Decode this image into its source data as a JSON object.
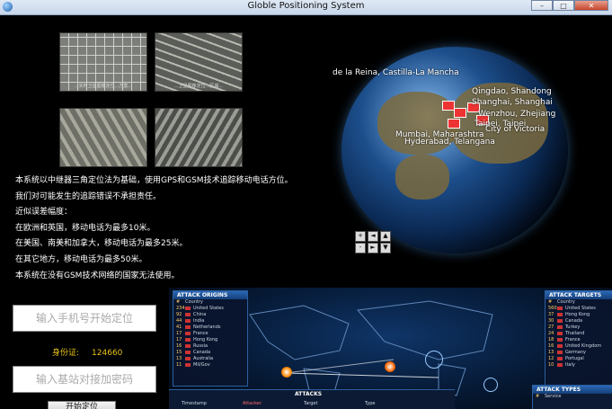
{
  "window": {
    "title": "Globle Positioning System"
  },
  "thumbnails": [
    {
      "caption": "...实时卫星图像定位...方案..."
    },
    {
      "caption": "...卫星图像定位...区域..."
    },
    {
      "caption": ""
    },
    {
      "caption": ""
    }
  ],
  "info_lines": [
    "本系统以中继器三角定位法为基础，使用GPS和GSM技术追踪移动电话方位。",
    "我们对可能发生的追踪错误不承担责任。",
    "近似误差幅度：",
    "在欧洲和英国，移动电话为最多10米。",
    "在美国、南美和加拿大，移动电话为最多25米。",
    "在其它地方，移动电话为最多50米。",
    "本系统在没有GSM技术网络的国家无法使用。"
  ],
  "phone_input": {
    "placeholder": "输入手机号开始定位"
  },
  "id_row": {
    "label": "身份证:",
    "value": "124660"
  },
  "base_input": {
    "placeholder": "输入基站对接加密码"
  },
  "start_button": {
    "label": "开始定位"
  },
  "globe": {
    "labels": [
      "de la Reina, Castilla-La Mancha",
      "Qingdao, Shandong",
      "Shanghai, Shanghai",
      "Wenzhou, Zhejiang",
      "Taipei, Taipei",
      "City of Victoria",
      "Mumbai, Maharashtra",
      "Hyderabad, Telangana"
    ],
    "nav_glyphs": {
      "plus": "+",
      "left": "◄",
      "up": "▲",
      "minus": "-",
      "right": "►",
      "down": "▼"
    }
  },
  "attack_map": {
    "origins": {
      "title": "ATTACK ORIGINS",
      "header": [
        "#",
        "Country"
      ],
      "rows": [
        {
          "n": "234",
          "name": "United States"
        },
        {
          "n": "92",
          "name": "China"
        },
        {
          "n": "44",
          "name": "India"
        },
        {
          "n": "41",
          "name": "Netherlands"
        },
        {
          "n": "17",
          "name": "France"
        },
        {
          "n": "17",
          "name": "Hong Kong"
        },
        {
          "n": "16",
          "name": "Russia"
        },
        {
          "n": "15",
          "name": "Canada"
        },
        {
          "n": "13",
          "name": "Australia"
        },
        {
          "n": "11",
          "name": "Mil/Gov"
        }
      ]
    },
    "targets": {
      "title": "ATTACK TARGETS",
      "header": [
        "#",
        "Country"
      ],
      "rows": [
        {
          "n": "560",
          "name": "United States"
        },
        {
          "n": "37",
          "name": "Hong Kong"
        },
        {
          "n": "30",
          "name": "Canada"
        },
        {
          "n": "27",
          "name": "Turkey"
        },
        {
          "n": "24",
          "name": "Thailand"
        },
        {
          "n": "18",
          "name": "France"
        },
        {
          "n": "16",
          "name": "United Kingdom"
        },
        {
          "n": "13",
          "name": "Germany"
        },
        {
          "n": "12",
          "name": "Portugal"
        },
        {
          "n": "10",
          "name": "Italy"
        }
      ]
    },
    "attacks": {
      "title": "ATTACKS",
      "columns": [
        "Timestamp",
        "Attacker",
        "Target",
        "Type"
      ]
    },
    "types": {
      "title": "ATTACK TYPES",
      "header": [
        "#",
        "Service"
      ]
    }
  }
}
